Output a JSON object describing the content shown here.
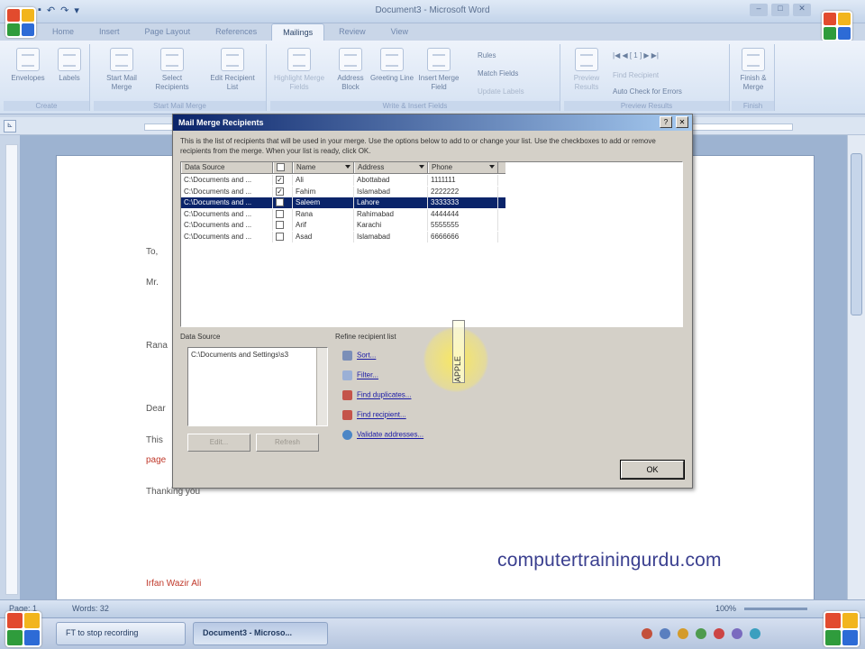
{
  "window": {
    "title": "Document3 - Microsoft Word"
  },
  "ribbon": {
    "tabs": [
      "Home",
      "Insert",
      "Page Layout",
      "References",
      "Mailings",
      "Review",
      "View"
    ],
    "active_tab": "Mailings",
    "groups": {
      "create": {
        "label": "Create",
        "buttons": [
          "Envelopes",
          "Labels"
        ]
      },
      "start_mail_merge": {
        "label": "Start Mail Merge",
        "buttons": [
          "Start Mail Merge",
          "Select Recipients",
          "Edit Recipient List"
        ]
      },
      "write_insert_fields": {
        "label": "Write & Insert Fields",
        "buttons": [
          "Highlight Merge Fields",
          "Address Block",
          "Greeting Line",
          "Insert Merge Field"
        ],
        "small": [
          "Rules",
          "Match Fields",
          "Update Labels"
        ]
      },
      "preview_results": {
        "label": "Preview Results",
        "buttons": [
          "Preview Results"
        ],
        "small": [
          "Find Recipient",
          "Auto Check for Errors"
        ]
      },
      "finish": {
        "label": "Finish",
        "buttons": [
          "Finish & Merge"
        ]
      }
    }
  },
  "document": {
    "lines": [
      "To,",
      "Mr.",
      "Rana",
      "Dear",
      "This",
      "page",
      "Thanking you",
      "Irfan Wazir Ali"
    ]
  },
  "watermark": "computertrainingurdu.com",
  "statusbar": {
    "page": "Page: 1",
    "words": "Words: 32",
    "zoom": "100%"
  },
  "taskbar": {
    "buttons": [
      "FT to stop recording",
      "Document3 - Microso..."
    ],
    "active": "Document3 - Microso..."
  },
  "dialog": {
    "title": "Mail Merge Recipients",
    "intro": "This is the list of recipients that will be used in your merge. Use the options below to add to or change your list. Use the checkboxes to add or remove recipients from the merge. When your list is ready, click OK.",
    "columns": [
      "Data Source",
      "",
      "Name",
      "Address",
      "Phone"
    ],
    "rows": [
      {
        "source": "C:\\Documents and ...",
        "checked": true,
        "name": "Ali",
        "address": "Abottabad",
        "phone": "1111111"
      },
      {
        "source": "C:\\Documents and ...",
        "checked": true,
        "name": "Fahim",
        "address": "Islamabad",
        "phone": "2222222"
      },
      {
        "source": "C:\\Documents and ...",
        "checked": false,
        "name": "Saleem",
        "address": "Lahore",
        "phone": "3333333"
      },
      {
        "source": "C:\\Documents and ...",
        "checked": false,
        "name": "Rana",
        "address": "Rahimabad",
        "phone": "4444444"
      },
      {
        "source": "C:\\Documents and ...",
        "checked": false,
        "name": "Arif",
        "address": "Karachi",
        "phone": "5555555"
      },
      {
        "source": "C:\\Documents and ...",
        "checked": false,
        "name": "Asad",
        "address": "Islamabad",
        "phone": "6666666"
      }
    ],
    "selected_row": 2,
    "cursor_label": "APPLE",
    "data_source_label": "Data Source",
    "data_source_item": "C:\\Documents and Settings\\s3",
    "edit_label": "Edit...",
    "refresh_label": "Refresh",
    "refine_label": "Refine recipient list",
    "refine_links": [
      "Sort...",
      "Filter...",
      "Find duplicates...",
      "Find recipient...",
      "Validate addresses..."
    ],
    "ok_label": "OK",
    "close_glyph": "✕",
    "help_glyph": "?"
  },
  "colors": {
    "dialog_title_start": "#0a246a",
    "selection": "#0a246a",
    "watermark": "#3a3f8f"
  }
}
